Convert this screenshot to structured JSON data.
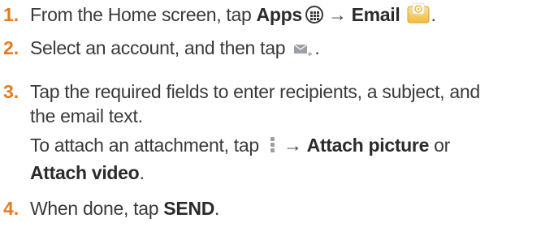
{
  "steps": [
    {
      "number": "1.",
      "lines": [
        {
          "prefix": "From the Home screen, tap ",
          "apps_label": "Apps",
          "arrow": "→",
          "email_label": "Email",
          "apps_icon": "apps-grid-icon",
          "email_icon": "email-app-icon"
        }
      ]
    },
    {
      "number": "2.",
      "lines": [
        {
          "text": "Select an account, and then tap ",
          "end": ".",
          "icon": "compose-email-icon"
        }
      ]
    },
    {
      "number": "3.",
      "lines": [
        {
          "text": "Tap the required fields to enter recipients, a subject, and"
        },
        {
          "text": "the email text."
        },
        {
          "prefix": "To attach an attachment, tap ",
          "arrow": "→",
          "bold": "Attach picture",
          "suffix": " or",
          "icon": "more-options-menu-icon"
        },
        {
          "bold": "Attach video",
          "suffix": "."
        }
      ]
    },
    {
      "number": "4.",
      "lines": [
        {
          "prefix": "When done, tap ",
          "bold": "SEND",
          "suffix": "."
        }
      ]
    }
  ],
  "colors": {
    "step_number": "#e8791e",
    "text": "#3a3a3a"
  }
}
